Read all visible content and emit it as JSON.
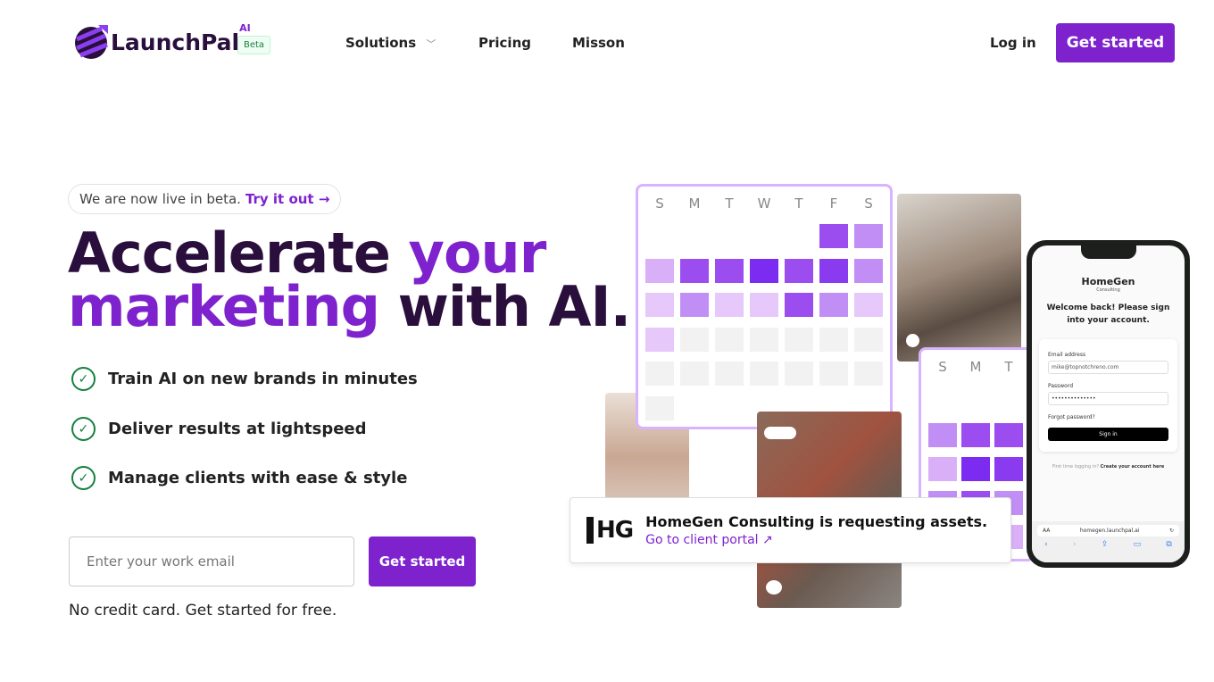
{
  "brand": {
    "name": "LaunchPal",
    "superscript": "AI",
    "badge": "Beta"
  },
  "nav": {
    "items": [
      "Solutions",
      "Pricing",
      "Misson"
    ],
    "login": "Log in",
    "cta": "Get started"
  },
  "hero": {
    "announcement": "We are now live in beta.",
    "announcement_link": "Try it out →",
    "title_1": "Accelerate",
    "title_2": "your",
    "title_3": "marketing",
    "title_4": "with AI.",
    "features": [
      "Train AI on new brands in minutes",
      "Deliver results at lightspeed",
      "Manage clients with ease & style"
    ],
    "email_placeholder": "Enter your work email",
    "cta": "Get started",
    "note": "No credit card. Get started for free."
  },
  "calendar": {
    "days": [
      "S",
      "M",
      "T",
      "W",
      "T",
      "F",
      "S"
    ],
    "days_small": [
      "S",
      "M",
      "T"
    ]
  },
  "notification": {
    "logo": "HG",
    "title": "HomeGen Consulting is requesting assets.",
    "link": "Go to client portal ↗"
  },
  "phone": {
    "brand": "HomeGen",
    "brand_sub": "Consulting",
    "heading": "Welcome back! Please sign into your account.",
    "email_label": "Email address",
    "email_value": "mike@topnotchreno.com",
    "password_label": "Password",
    "password_value": "••••••••••••••",
    "forgot": "Forgot password?",
    "sign_in": "Sign in",
    "footer_q": "First time logging in?",
    "footer_link": "Create your account here",
    "url": "homegen.launchpal.ai",
    "aa": "AA"
  },
  "colors": {
    "accent": "#7e22ce",
    "dark": "#2a0f3d"
  }
}
